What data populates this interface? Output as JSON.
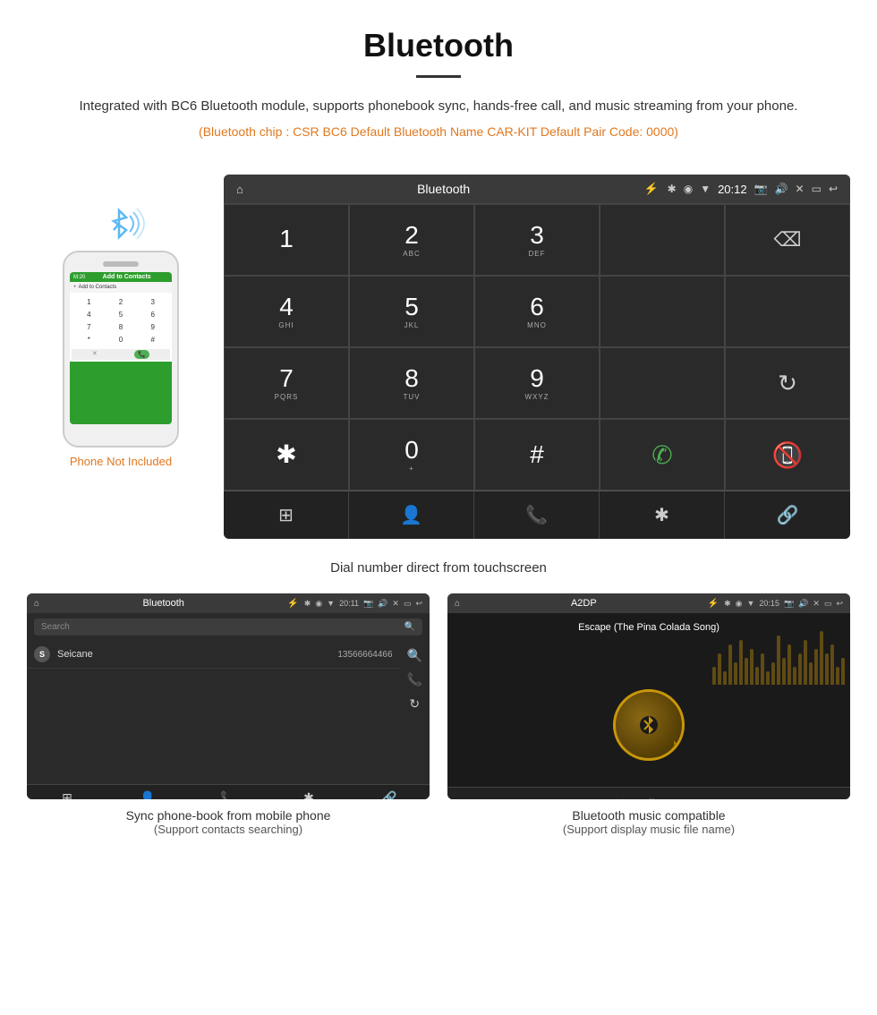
{
  "header": {
    "title": "Bluetooth",
    "description": "Integrated with BC6 Bluetooth module, supports phonebook sync, hands-free call, and music streaming from your phone.",
    "specs": "(Bluetooth chip : CSR BC6    Default Bluetooth Name CAR-KIT    Default Pair Code: 0000)"
  },
  "dialpad_screen": {
    "topbar_title": "Bluetooth",
    "time": "20:12",
    "keys": [
      {
        "num": "1",
        "sub": ""
      },
      {
        "num": "2",
        "sub": "ABC"
      },
      {
        "num": "3",
        "sub": "DEF"
      },
      {
        "num": "",
        "sub": ""
      },
      {
        "num": "⌫",
        "sub": ""
      },
      {
        "num": "4",
        "sub": "GHI"
      },
      {
        "num": "5",
        "sub": "JKL"
      },
      {
        "num": "6",
        "sub": "MNO"
      },
      {
        "num": "",
        "sub": ""
      },
      {
        "num": "",
        "sub": ""
      },
      {
        "num": "7",
        "sub": "PQRS"
      },
      {
        "num": "8",
        "sub": "TUV"
      },
      {
        "num": "9",
        "sub": "WXYZ"
      },
      {
        "num": "",
        "sub": ""
      },
      {
        "num": "↻",
        "sub": ""
      },
      {
        "num": "✱",
        "sub": ""
      },
      {
        "num": "0",
        "sub": "+"
      },
      {
        "num": "#",
        "sub": ""
      },
      {
        "num": "✆",
        "sub": ""
      },
      {
        "num": "",
        "sub": ""
      }
    ],
    "bottom_icons": [
      "⊞",
      "👤",
      "📞",
      "✱",
      "🔗"
    ],
    "caption": "Dial number direct from touchscreen"
  },
  "phonebook_panel": {
    "title": "Bluetooth",
    "time": "20:11",
    "search_placeholder": "Search",
    "contacts": [
      {
        "letter": "S",
        "name": "Seicane",
        "number": "13566664466"
      }
    ],
    "caption_main": "Sync phone-book from mobile phone",
    "caption_sub": "(Support contacts searching)"
  },
  "music_panel": {
    "title": "A2DP",
    "time": "20:15",
    "song_title": "Escape (The Pina Colada Song)",
    "caption_main": "Bluetooth music compatible",
    "caption_sub": "(Support display music file name)"
  },
  "phone_aside": {
    "not_included_text": "Phone Not Included"
  },
  "colors": {
    "accent_orange": "#e07820",
    "screen_bg": "#2a2a2a",
    "topbar_bg": "#3a3a3a"
  }
}
